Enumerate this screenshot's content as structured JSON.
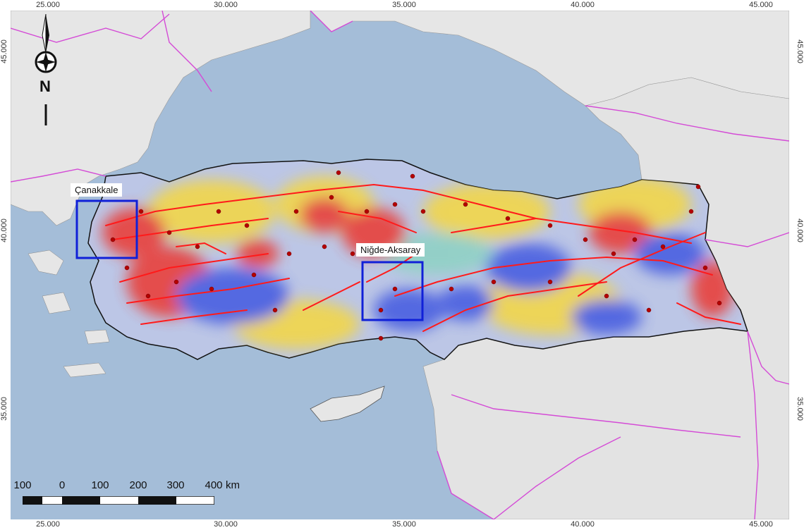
{
  "map": {
    "lon_ticks": [
      "25.000",
      "30.000",
      "35.000",
      "40.000",
      "45.000"
    ],
    "lat_ticks": [
      "45.000",
      "40.000",
      "35.000"
    ],
    "regions": [
      {
        "label": "Çanakkale"
      },
      {
        "label": "Niğde-Aksaray"
      }
    ],
    "compass_label": "N",
    "scale_bar": {
      "labels": [
        "100",
        "0",
        "100",
        "200",
        "300",
        "400"
      ],
      "unit": "km"
    },
    "colors": {
      "sea": "#a4bdd8",
      "land": "#e9e9e9",
      "faults": "#ff1a1a",
      "borders": "#d44bd6",
      "region_box": "#1020d8",
      "low": "#4a5fe0",
      "high": "#e8403a"
    }
  }
}
